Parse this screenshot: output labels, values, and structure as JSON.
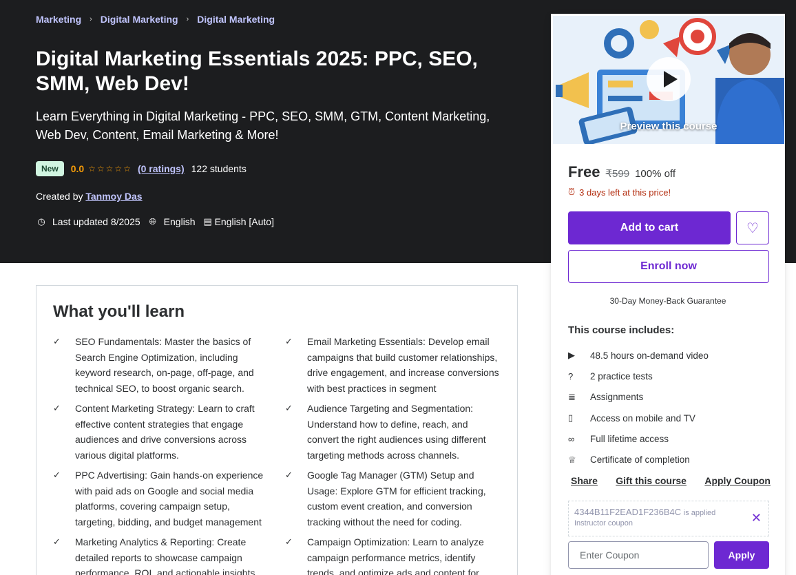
{
  "breadcrumb": [
    "Marketing",
    "Digital Marketing",
    "Digital Marketing"
  ],
  "course": {
    "title": "Digital Marketing Essentials 2025: PPC, SEO, SMM, Web Dev!",
    "subtitle": "Learn Everything in Digital Marketing - PPC, SEO, SMM, GTM, Content Marketing, Web Dev, Content, Email Marketing & More!",
    "badge": "New",
    "rating": "0.0",
    "ratings_count": "(0 ratings)",
    "students": "122 students",
    "created_by_label": "Created by",
    "instructor": "Tanmoy Das",
    "last_updated": "Last updated 8/2025",
    "language": "English",
    "captions": "English [Auto]"
  },
  "learn": {
    "title": "What you'll learn",
    "items": [
      "SEO Fundamentals: Master the basics of Search Engine Optimization, including keyword research, on-page, off-page, and technical SEO, to boost organic search.",
      "Email Marketing Essentials: Develop email campaigns that build customer relationships, drive engagement, and increase conversions with best practices in segment",
      "Content Marketing Strategy: Learn to craft effective content strategies that engage audiences and drive conversions across various digital platforms.",
      "Audience Targeting and Segmentation: Understand how to define, reach, and convert the right audiences using different targeting methods across channels.",
      "PPC Advertising: Gain hands-on experience with paid ads on Google and social media platforms, covering campaign setup, targeting, bidding, and budget management",
      "Google Tag Manager (GTM) Setup and Usage: Explore GTM for efficient tracking, custom event creation, and conversion tracking without the need for coding.",
      "Marketing Analytics & Reporting: Create detailed reports to showcase campaign performance, ROI, and actionable insights for",
      "Campaign Optimization: Learn to analyze campaign performance metrics, identify trends, and optimize ads and content for"
    ]
  },
  "sidebar": {
    "preview_label": "Preview this course",
    "price": "Free",
    "original_price": "₹599",
    "discount": "100% off",
    "countdown": "3 days left at this price!",
    "add_to_cart": "Add to cart",
    "enroll": "Enroll now",
    "guarantee": "30-Day Money-Back Guarantee",
    "includes_title": "This course includes:",
    "includes": [
      {
        "icon": "video-icon",
        "glyph": "▶",
        "text": "48.5 hours on-demand video"
      },
      {
        "icon": "question-icon",
        "glyph": "?",
        "text": "2 practice tests"
      },
      {
        "icon": "clipboard-icon",
        "glyph": "≣",
        "text": "Assignments"
      },
      {
        "icon": "mobile-icon",
        "glyph": "▯",
        "text": "Access on mobile and TV"
      },
      {
        "icon": "infinity-icon",
        "glyph": "∞",
        "text": "Full lifetime access"
      },
      {
        "icon": "trophy-icon",
        "glyph": "♕",
        "text": "Certificate of completion"
      }
    ],
    "links": {
      "share": "Share",
      "gift": "Gift this course",
      "coupon": "Apply Coupon"
    },
    "applied_coupon": {
      "code": "4344B11F2EAD1F236B4C",
      "status": "is applied",
      "type": "Instructor coupon"
    },
    "coupon_input": {
      "placeholder": "Enter Coupon",
      "value": ""
    },
    "apply": "Apply"
  },
  "colors": {
    "accent": "#6d28d2",
    "hero_bg": "#1c1d1f",
    "link": "#c0c4fc",
    "star": "#f69c08",
    "warning": "#b32d0f"
  }
}
